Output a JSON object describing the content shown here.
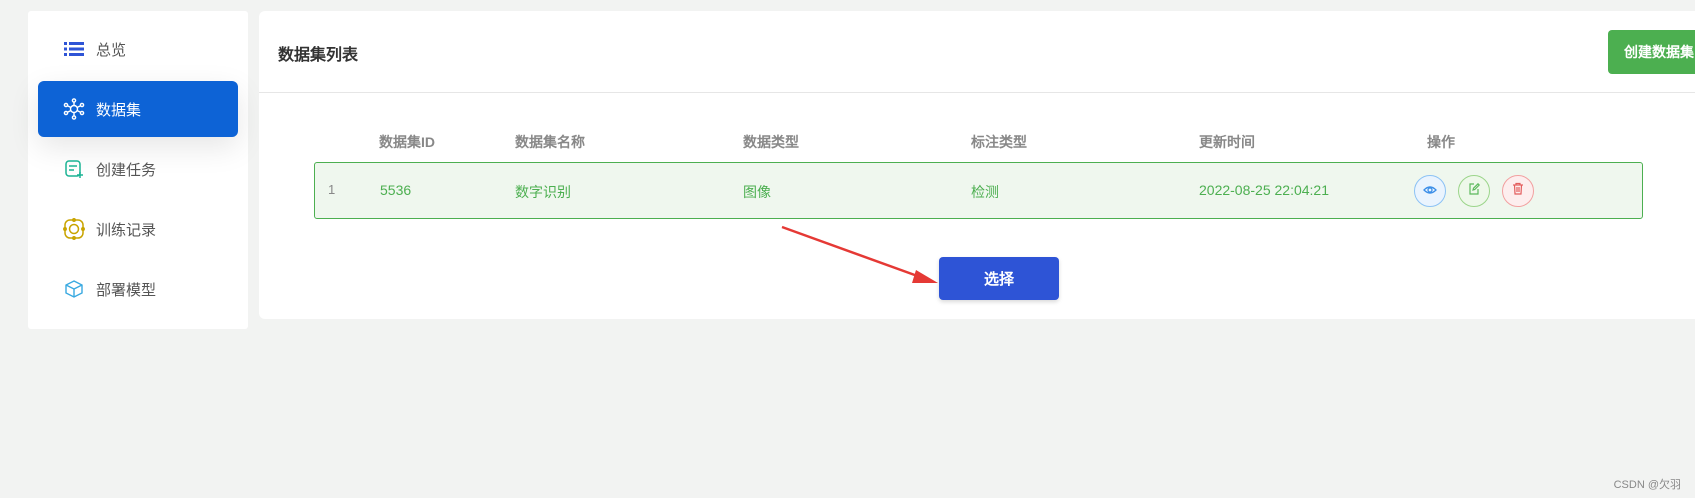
{
  "sidebar": {
    "items": [
      {
        "label": "总览",
        "icon": "list-icon",
        "active": false
      },
      {
        "label": "数据集",
        "icon": "dataset-network-icon",
        "active": true
      },
      {
        "label": "创建任务",
        "icon": "create-task-icon",
        "active": false
      },
      {
        "label": "训练记录",
        "icon": "training-record-icon",
        "active": false
      },
      {
        "label": "部署模型",
        "icon": "deploy-cube-icon",
        "active": false
      }
    ]
  },
  "main": {
    "title": "数据集列表",
    "create_button": "创建数据集",
    "table": {
      "headers": [
        "数据集ID",
        "数据集名称",
        "数据类型",
        "标注类型",
        "更新时间",
        "操作"
      ],
      "rows": [
        {
          "index": "1",
          "id": "5536",
          "name": "数字识别",
          "data_type": "图像",
          "label_type": "检测",
          "updated": "2022-08-25 22:04:21"
        }
      ],
      "actions": [
        "eye-icon",
        "edit-icon",
        "delete-icon"
      ]
    },
    "select_button": "选择"
  },
  "watermark": "CSDN @欠羽",
  "colors": {
    "accent": "#0d63d6",
    "success": "#4caf50",
    "select": "#2e54d6",
    "annotation": "#e53935"
  }
}
